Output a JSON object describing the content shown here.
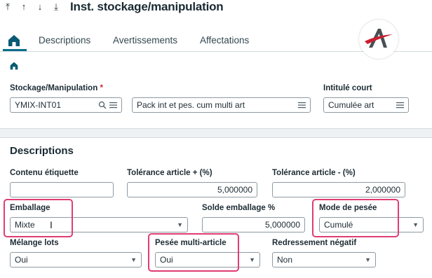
{
  "header": {
    "title": "Inst. stockage/manipulation",
    "nav": [
      "⤒",
      "↑",
      "↓",
      "⤓"
    ]
  },
  "tabs": [
    {
      "label": "Descriptions"
    },
    {
      "label": "Avertissements"
    },
    {
      "label": "Affectations"
    }
  ],
  "colors": {
    "accent": "#0a6e8a",
    "highlight": "#e03c73",
    "required": "#d4213d",
    "logo_red": "#c8202f"
  },
  "top_section": {
    "stockage_label": "Stockage/Manipulation",
    "required_mark": "*",
    "stockage_value": "YMIX-INT01",
    "description_value": "Pack int et pes. cum multi art",
    "intitule_label": "Intitulé court",
    "intitule_value": "Cumulée art"
  },
  "descriptions": {
    "title": "Descriptions",
    "contenu_label": "Contenu étiquette",
    "contenu_value": "",
    "tol_plus_label": "Tolérance article + (%)",
    "tol_plus_value": "5,000000",
    "tol_minus_label": "Tolérance article - (%)",
    "tol_minus_value": "2,000000",
    "emballage_label": "Emballage",
    "emballage_value": "Mixte",
    "solde_label": "Solde emballage %",
    "solde_value": "5,000000",
    "mode_label": "Mode de pesée",
    "mode_value": "Cumulé",
    "melange_label": "Mélange lots",
    "melange_value": "Oui",
    "pesee_label": "Pesée multi-article",
    "pesee_value": "Oui",
    "redressement_label": "Redressement négatif",
    "redressement_value": "Non"
  }
}
